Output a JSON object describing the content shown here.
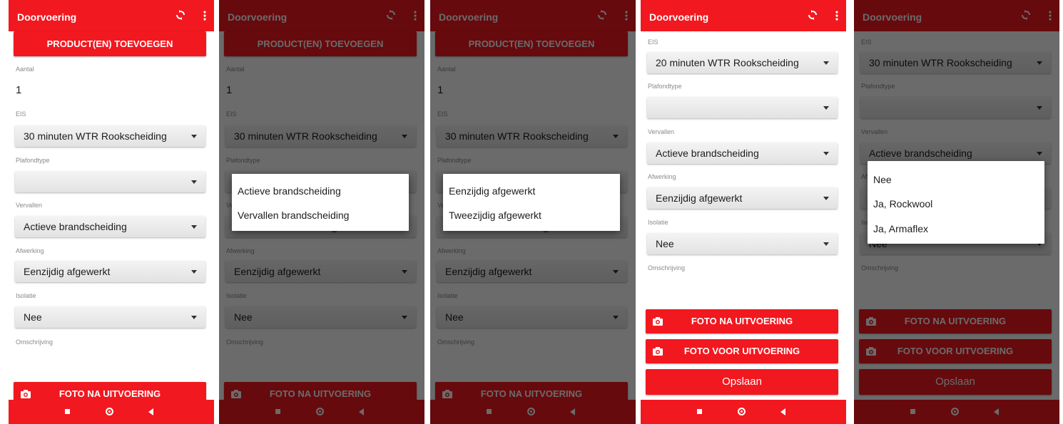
{
  "app": {
    "title": "Doorvoering"
  },
  "buttons": {
    "add_products": "PRODUCT(EN) TOEVOEGEN",
    "photo_after": "FOTO NA UITVOERING",
    "photo_before": "FOTO VOOR UITVOERING",
    "save": "Opslaan"
  },
  "labels": {
    "aantal": "Aantal",
    "eis": "EIS",
    "plafondtype": "Plafondtype",
    "vervallen": "Vervallen",
    "afwerking": "Afwerking",
    "isolatie": "Isolatie",
    "omschrijving": "Omschrijving"
  },
  "form": {
    "aantal": "1",
    "eis": "30 minuten WTR Rookscheiding",
    "plafondtype": "",
    "vervallen": "Actieve brandscheiding",
    "afwerking": "Eenzijdig afgewerkt",
    "isolatie": "Nee"
  },
  "form_screen4": {
    "eis": "20 minuten WTR Rookscheiding"
  },
  "dialogs": {
    "vervallen_options": [
      "Actieve brandscheiding",
      "Vervallen brandscheiding"
    ],
    "afwerking_options": [
      "Eenzijdig afgewerkt",
      "Tweezijdig afgewerkt"
    ],
    "isolatie_options": [
      "Nee",
      "Ja, Rockwool",
      "Ja, Armaflex"
    ]
  },
  "colors": {
    "primary": "#f2181f",
    "overlay": "rgba(0,0,0,0.58)"
  },
  "icons": [
    "sync-icon",
    "overflow-menu-icon",
    "camera-icon",
    "nav-recents-icon",
    "nav-home-icon",
    "nav-back-icon"
  ]
}
